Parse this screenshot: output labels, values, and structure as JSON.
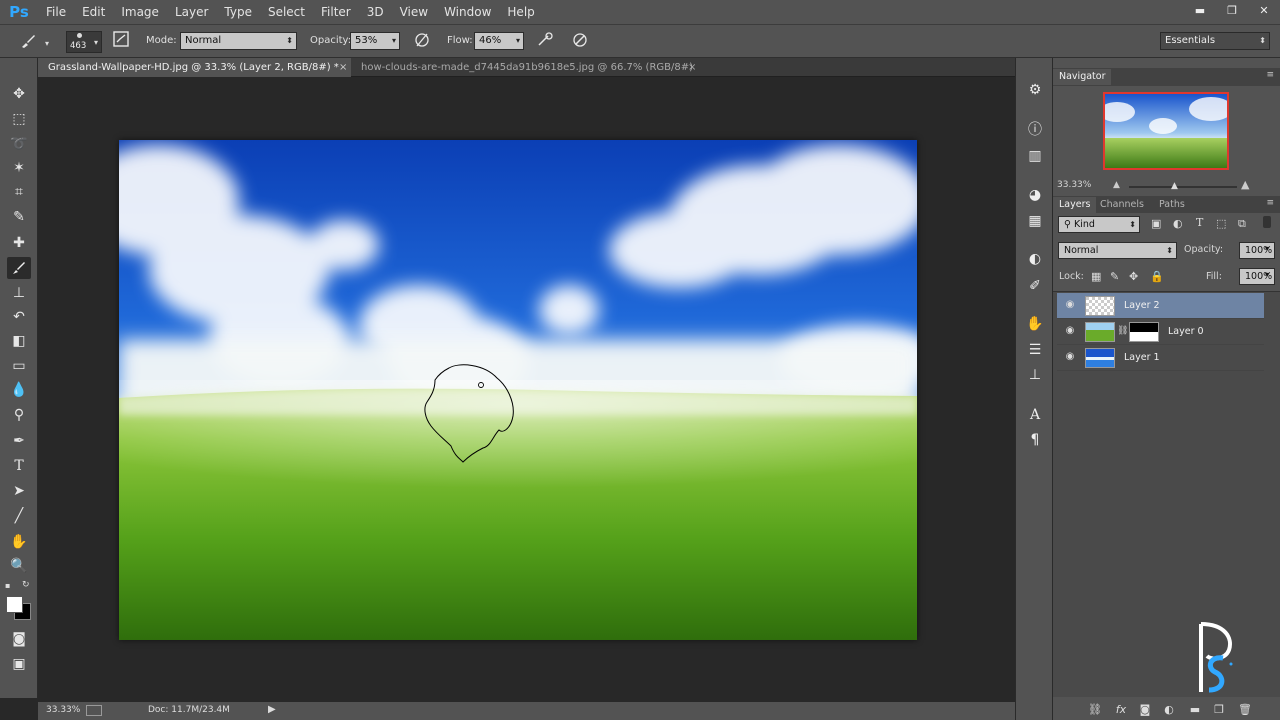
{
  "app": {
    "logo": "Ps"
  },
  "menu": [
    "File",
    "Edit",
    "Image",
    "Layer",
    "Type",
    "Select",
    "Filter",
    "3D",
    "View",
    "Window",
    "Help"
  ],
  "window_controls": {
    "minimize": "▬",
    "restore": "❐",
    "close": "✕"
  },
  "options": {
    "brush_size": "463",
    "mode_label": "Mode:",
    "mode_value": "Normal",
    "opacity_label": "Opacity:",
    "opacity_value": "53%",
    "flow_label": "Flow:",
    "flow_value": "46%",
    "workspace": "Essentials"
  },
  "tabs": [
    {
      "label": "Grassland-Wallpaper-HD.jpg @ 33.3% (Layer 2, RGB/8#) *",
      "active": true
    },
    {
      "label": "how-clouds-are-made_d7445da91b9618e5.jpg @ 66.7% (RGB/8#)",
      "active": false
    }
  ],
  "tab_close": "×",
  "status": {
    "zoom": "33.33%",
    "doc": "Doc: 11.7M/23.4M"
  },
  "navigator": {
    "title": "Navigator",
    "zoom": "33.33%"
  },
  "layers_panel": {
    "tabs": [
      "Layers",
      "Channels",
      "Paths"
    ],
    "filter": "Kind",
    "blend_mode": "Normal",
    "opacity_label": "Opacity:",
    "opacity_value": "100%",
    "lock_label": "Lock:",
    "fill_label": "Fill:",
    "fill_value": "100%",
    "layers": [
      {
        "name": "Layer 2",
        "selected": true
      },
      {
        "name": "Layer 0",
        "selected": false
      },
      {
        "name": "Layer 1",
        "selected": false
      }
    ]
  },
  "colors": {
    "ui_panel": "#535353",
    "canvas_bg": "#282828",
    "selection": "#6e84a4",
    "ps_blue": "#31a8ff"
  }
}
